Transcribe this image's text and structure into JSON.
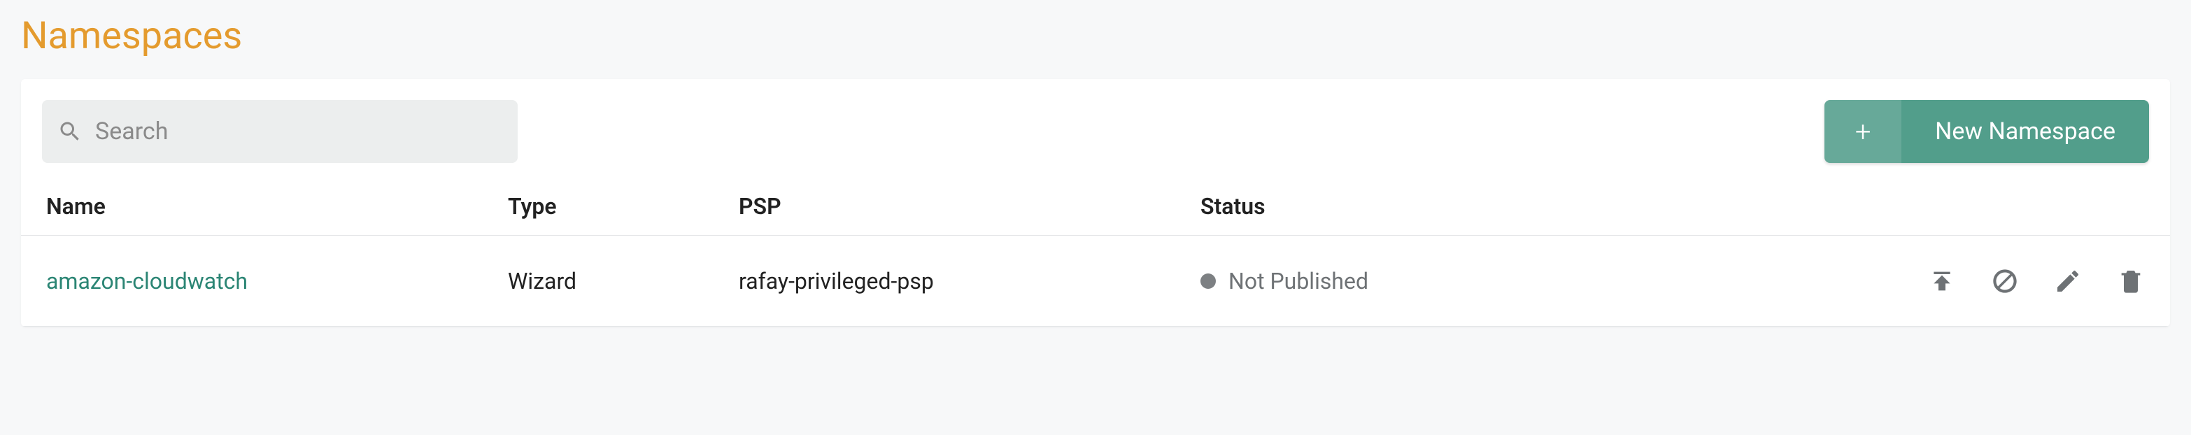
{
  "page_title": "Namespaces",
  "search": {
    "placeholder": "Search",
    "value": ""
  },
  "new_button": {
    "label": "New Namespace",
    "plus": "+"
  },
  "columns": {
    "name": "Name",
    "type": "Type",
    "psp": "PSP",
    "status": "Status"
  },
  "rows": [
    {
      "name": "amazon-cloudwatch",
      "type": "Wizard",
      "psp": "rafay-privileged-psp",
      "status_label": "Not Published",
      "status_color": "#7d8083"
    }
  ],
  "action_tooltips": {
    "publish": "Publish",
    "block": "Block",
    "edit": "Edit",
    "delete": "Delete"
  }
}
